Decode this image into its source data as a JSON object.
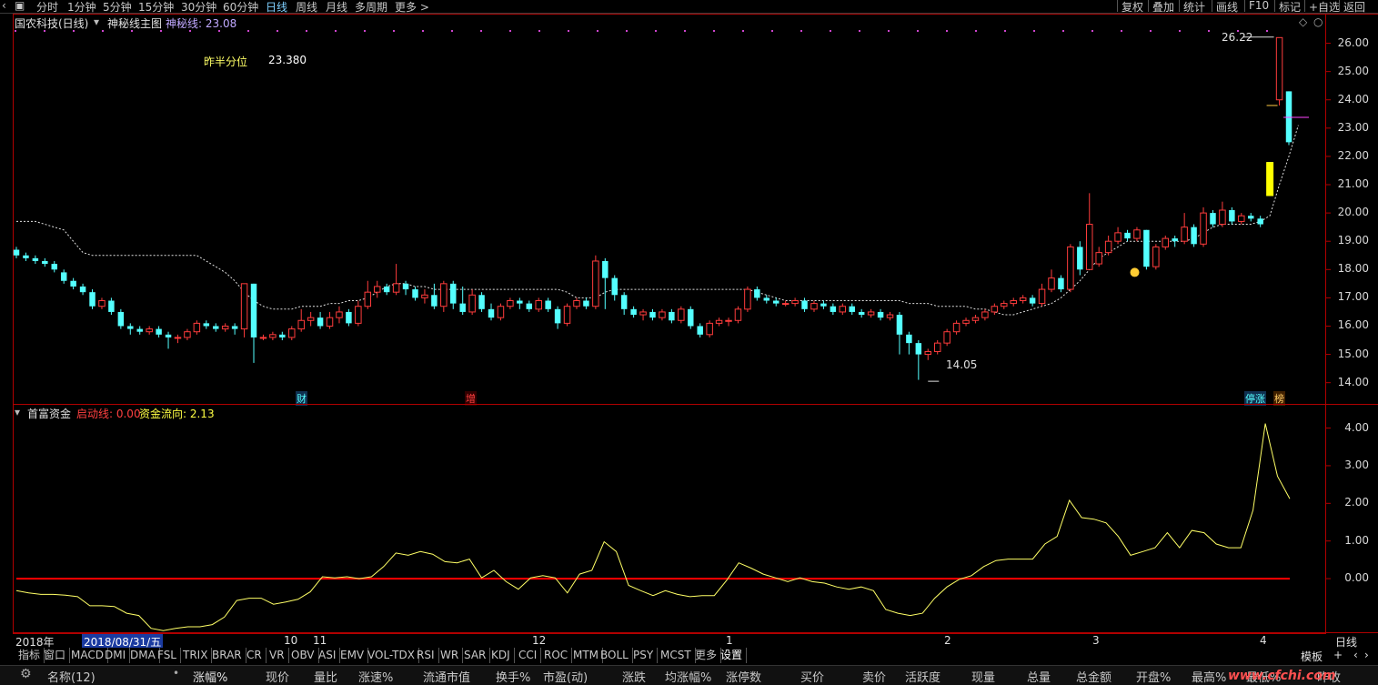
{
  "toolbar": {
    "periods": [
      "分时",
      "1分钟",
      "5分钟",
      "15分钟",
      "30分钟",
      "60分钟",
      "日线",
      "周线",
      "月线",
      "多周期",
      "更多 >"
    ],
    "active_period": "日线",
    "right_buttons": [
      "复权",
      "叠加",
      "统计",
      "画线",
      "F10",
      "标记",
      "+自选",
      "返回"
    ]
  },
  "main_pane": {
    "title": "国农科技(日线)",
    "indicator_name": "神秘线主图",
    "indicator_value_label": "神秘线: 23.08",
    "half_label": "昨半分位",
    "half_value": "23.380",
    "high_label": "26.22",
    "low_label": "14.05",
    "event_marks": [
      "财",
      "增",
      "停涨",
      "榜"
    ],
    "y_ticks": [
      "26.00",
      "25.00",
      "24.00",
      "23.00",
      "22.00",
      "21.00",
      "20.00",
      "19.00",
      "18.00",
      "17.00",
      "16.00",
      "15.00",
      "14.00"
    ]
  },
  "sub_pane": {
    "name": "首富资金",
    "line1_label": "启动线: 0.00",
    "line2_label": "资金流向: 2.13",
    "y_ticks": [
      "4.00",
      "3.00",
      "2.00",
      "1.00",
      "0.00"
    ]
  },
  "time_axis": {
    "year": "2018年",
    "cursor_date": "2018/08/31/五",
    "months": [
      "10",
      "11",
      "12",
      "1",
      "2",
      "3",
      "4"
    ],
    "period_label": "日线"
  },
  "indicator_tabs": [
    "指标",
    "窗口",
    "MACD",
    "DMI",
    "DMA",
    "FSL",
    "TRIX",
    "BRAR",
    "CR",
    "VR",
    "OBV",
    "ASI",
    "EMV",
    "VOL-TDX",
    "RSI",
    "WR",
    "SAR",
    "KDJ",
    "CCI",
    "ROC",
    "MTM",
    "BOLL",
    "PSY",
    "MCST",
    "更多",
    "设置"
  ],
  "template_label": "模板",
  "quote_header": [
    "名称(12)",
    "涨幅%",
    "现价",
    "量比",
    "涨速%",
    "流通市值",
    "换手%",
    "市盈(动)",
    "涨跌",
    "均涨幅%",
    "涨停数",
    "买价",
    "卖价",
    "活跃度",
    "现量",
    "总量",
    "总金额",
    "开盘%",
    "最高%",
    "最低%",
    "昨收"
  ],
  "watermark": "www.cfchi.com",
  "colors": {
    "up": "#ff3c3c",
    "down": "#54ffff",
    "yellow": "#ffff00",
    "red_line": "#ff0000",
    "border": "#b00000"
  },
  "chart_data": [
    {
      "type": "candlestick",
      "ylim": [
        13.7,
        26.5
      ],
      "candles": [
        [
          18.7,
          18.5,
          18.8,
          18.4
        ],
        [
          18.5,
          18.4,
          18.6,
          18.3
        ],
        [
          18.4,
          18.3,
          18.5,
          18.2
        ],
        [
          18.3,
          18.2,
          18.4,
          18.1
        ],
        [
          18.2,
          18.0,
          18.3,
          17.9
        ],
        [
          17.9,
          17.6,
          18.0,
          17.5
        ],
        [
          17.6,
          17.4,
          17.7,
          17.3
        ],
        [
          17.4,
          17.2,
          17.5,
          17.1
        ],
        [
          17.2,
          16.7,
          17.3,
          16.6
        ],
        [
          16.7,
          16.9,
          17.0,
          16.6
        ],
        [
          16.9,
          16.5,
          17.0,
          16.4
        ],
        [
          16.5,
          16.0,
          16.6,
          15.9
        ],
        [
          16.0,
          15.9,
          16.1,
          15.7
        ],
        [
          15.9,
          15.8,
          16.0,
          15.7
        ],
        [
          15.8,
          15.9,
          16.0,
          15.7
        ],
        [
          15.9,
          15.7,
          16.0,
          15.6
        ],
        [
          15.7,
          15.6,
          15.8,
          15.2
        ],
        [
          15.6,
          15.6,
          15.7,
          15.4
        ],
        [
          15.6,
          15.8,
          15.9,
          15.5
        ],
        [
          15.8,
          16.1,
          16.2,
          15.7
        ],
        [
          16.1,
          16.0,
          16.2,
          15.9
        ],
        [
          16.0,
          15.9,
          16.1,
          15.8
        ],
        [
          15.9,
          16.0,
          16.1,
          15.8
        ],
        [
          16.0,
          15.9,
          16.1,
          15.7
        ],
        [
          15.9,
          17.5,
          17.5,
          15.6
        ],
        [
          17.5,
          15.6,
          17.5,
          14.7
        ],
        [
          15.6,
          15.6,
          15.7,
          15.5
        ],
        [
          15.6,
          15.7,
          15.8,
          15.5
        ],
        [
          15.7,
          15.6,
          15.8,
          15.5
        ],
        [
          15.6,
          15.9,
          16.0,
          15.5
        ],
        [
          15.9,
          16.2,
          16.6,
          15.8
        ],
        [
          16.2,
          16.3,
          16.5,
          16.0
        ],
        [
          16.3,
          16.0,
          16.5,
          15.9
        ],
        [
          16.0,
          16.3,
          16.5,
          15.9
        ],
        [
          16.3,
          16.5,
          16.7,
          16.1
        ],
        [
          16.5,
          16.1,
          16.6,
          16.0
        ],
        [
          16.1,
          16.7,
          16.9,
          16.0
        ],
        [
          16.7,
          17.2,
          17.6,
          16.6
        ],
        [
          17.2,
          17.4,
          17.6,
          17.0
        ],
        [
          17.4,
          17.2,
          17.5,
          17.1
        ],
        [
          17.2,
          17.5,
          18.2,
          17.1
        ],
        [
          17.5,
          17.3,
          17.6,
          17.1
        ],
        [
          17.3,
          17.0,
          17.4,
          16.9
        ],
        [
          17.0,
          17.1,
          17.3,
          16.8
        ],
        [
          17.1,
          16.7,
          17.5,
          16.6
        ],
        [
          16.7,
          17.5,
          17.6,
          16.5
        ],
        [
          17.5,
          16.8,
          17.6,
          16.6
        ],
        [
          16.8,
          16.5,
          17.4,
          16.4
        ],
        [
          16.5,
          17.1,
          17.3,
          16.4
        ],
        [
          17.1,
          16.6,
          17.2,
          16.5
        ],
        [
          16.6,
          16.3,
          16.8,
          16.2
        ],
        [
          16.3,
          16.7,
          16.8,
          16.2
        ],
        [
          16.7,
          16.9,
          17.0,
          16.6
        ],
        [
          16.9,
          16.8,
          17.0,
          16.6
        ],
        [
          16.8,
          16.6,
          16.9,
          16.5
        ],
        [
          16.6,
          16.9,
          17.0,
          16.5
        ],
        [
          16.9,
          16.6,
          17.0,
          16.5
        ],
        [
          16.6,
          16.1,
          16.7,
          15.9
        ],
        [
          16.1,
          16.7,
          16.8,
          16.0
        ],
        [
          16.7,
          16.9,
          17.0,
          16.6
        ],
        [
          16.9,
          16.7,
          17.0,
          16.6
        ],
        [
          16.7,
          18.3,
          18.5,
          16.6
        ],
        [
          18.3,
          17.7,
          18.4,
          16.6
        ],
        [
          17.7,
          17.1,
          17.8,
          16.9
        ],
        [
          17.1,
          16.6,
          17.2,
          16.4
        ],
        [
          16.6,
          16.4,
          16.7,
          16.3
        ],
        [
          16.4,
          16.5,
          16.6,
          16.2
        ],
        [
          16.5,
          16.3,
          16.6,
          16.2
        ],
        [
          16.3,
          16.5,
          16.6,
          16.2
        ],
        [
          16.5,
          16.2,
          16.6,
          16.1
        ],
        [
          16.2,
          16.6,
          16.7,
          16.1
        ],
        [
          16.6,
          16.0,
          16.7,
          15.9
        ],
        [
          16.0,
          15.7,
          16.1,
          15.6
        ],
        [
          15.7,
          16.1,
          16.2,
          15.6
        ],
        [
          16.1,
          16.2,
          16.3,
          16.0
        ],
        [
          16.2,
          16.2,
          16.3,
          16.0
        ],
        [
          16.2,
          16.6,
          16.7,
          16.1
        ],
        [
          16.6,
          17.3,
          17.4,
          16.5
        ],
        [
          17.3,
          17.0,
          17.4,
          16.9
        ],
        [
          17.0,
          16.9,
          17.1,
          16.8
        ],
        [
          16.9,
          16.8,
          17.0,
          16.7
        ],
        [
          16.8,
          16.8,
          16.9,
          16.7
        ],
        [
          16.8,
          16.9,
          17.0,
          16.7
        ],
        [
          16.9,
          16.6,
          17.0,
          16.5
        ],
        [
          16.6,
          16.8,
          16.9,
          16.5
        ],
        [
          16.8,
          16.7,
          16.9,
          16.6
        ],
        [
          16.7,
          16.5,
          16.8,
          16.4
        ],
        [
          16.5,
          16.7,
          16.8,
          16.4
        ],
        [
          16.7,
          16.5,
          16.8,
          16.4
        ],
        [
          16.5,
          16.4,
          16.6,
          16.3
        ],
        [
          16.4,
          16.5,
          16.6,
          16.3
        ],
        [
          16.5,
          16.3,
          16.6,
          16.2
        ],
        [
          16.3,
          16.4,
          16.5,
          16.2
        ],
        [
          16.4,
          15.7,
          16.5,
          15.0
        ],
        [
          15.7,
          15.4,
          15.8,
          15.0
        ],
        [
          15.4,
          15.0,
          15.5,
          14.1
        ],
        [
          15.0,
          15.1,
          15.2,
          14.8
        ],
        [
          15.1,
          15.4,
          15.5,
          15.0
        ],
        [
          15.4,
          15.8,
          15.9,
          15.3
        ],
        [
          15.8,
          16.1,
          16.2,
          15.7
        ],
        [
          16.1,
          16.2,
          16.3,
          16.0
        ],
        [
          16.2,
          16.3,
          16.4,
          16.1
        ],
        [
          16.3,
          16.5,
          16.6,
          16.2
        ],
        [
          16.5,
          16.7,
          16.8,
          16.4
        ],
        [
          16.7,
          16.8,
          16.9,
          16.6
        ],
        [
          16.8,
          16.9,
          17.0,
          16.7
        ],
        [
          16.9,
          17.0,
          17.1,
          16.8
        ],
        [
          17.0,
          16.8,
          17.1,
          16.7
        ],
        [
          16.8,
          17.3,
          17.5,
          16.7
        ],
        [
          17.3,
          17.7,
          18.0,
          17.2
        ],
        [
          17.7,
          17.3,
          17.8,
          17.2
        ],
        [
          17.3,
          18.8,
          18.9,
          17.2
        ],
        [
          18.8,
          18.0,
          19.0,
          17.8
        ],
        [
          18.0,
          19.6,
          20.7,
          19.3
        ],
        [
          18.2,
          18.6,
          18.8,
          18.1
        ],
        [
          18.6,
          19.0,
          19.2,
          18.5
        ],
        [
          19.0,
          19.3,
          19.5,
          18.9
        ],
        [
          19.3,
          19.1,
          19.4,
          19.0
        ],
        [
          19.1,
          19.4,
          19.5,
          19.0
        ],
        [
          19.4,
          18.1,
          19.4,
          18.0
        ],
        [
          18.1,
          18.8,
          18.9,
          18.0
        ],
        [
          18.8,
          19.1,
          19.2,
          18.7
        ],
        [
          19.1,
          19.0,
          19.2,
          18.8
        ],
        [
          19.0,
          19.5,
          20.0,
          18.9
        ],
        [
          19.5,
          18.9,
          19.6,
          18.8
        ],
        [
          18.9,
          20.0,
          20.2,
          18.8
        ],
        [
          20.0,
          19.6,
          20.1,
          19.5
        ],
        [
          19.6,
          20.1,
          20.4,
          19.5
        ],
        [
          20.1,
          19.7,
          20.2,
          19.6
        ],
        [
          19.7,
          19.9,
          20.0,
          19.6
        ],
        [
          19.9,
          19.8,
          20.0,
          19.7
        ],
        [
          19.8,
          19.6,
          19.9,
          19.5
        ],
        [
          21.8,
          20.6,
          21.8,
          20.6
        ],
        [
          24.0,
          26.2,
          26.2,
          23.8
        ],
        [
          24.3,
          22.5,
          24.3,
          22.4
        ]
      ],
      "line": [
        19.7,
        19.7,
        19.7,
        19.6,
        19.5,
        19.4,
        19.0,
        18.6,
        18.5,
        18.5,
        18.5,
        18.5,
        18.5,
        18.5,
        18.5,
        18.5,
        18.5,
        18.5,
        18.5,
        18.5,
        18.3,
        18.1,
        17.9,
        17.6,
        17.2,
        16.9,
        16.7,
        16.6,
        16.6,
        16.6,
        16.7,
        16.7,
        16.7,
        16.8,
        16.8,
        16.9,
        16.9,
        17.0,
        17.2,
        17.4,
        17.5,
        17.5,
        17.4,
        17.4,
        17.3,
        17.3,
        17.3,
        17.3,
        17.3,
        17.3,
        17.3,
        17.3,
        17.3,
        17.3,
        17.3,
        17.3,
        17.3,
        17.3,
        17.2,
        17.0,
        17.0,
        17.0,
        17.2,
        17.3,
        17.3,
        17.3,
        17.3,
        17.3,
        17.3,
        17.3,
        17.3,
        17.3,
        17.3,
        17.3,
        17.3,
        17.3,
        17.3,
        17.3,
        17.2,
        17.1,
        17.0,
        16.9,
        16.9,
        16.9,
        16.9,
        16.9,
        16.9,
        16.9,
        16.9,
        16.9,
        16.9,
        16.9,
        16.9,
        16.9,
        16.8,
        16.8,
        16.8,
        16.7,
        16.7,
        16.7,
        16.7,
        16.6,
        16.6,
        16.5,
        16.4,
        16.4,
        16.5,
        16.6,
        16.7,
        16.8,
        17.0,
        17.3,
        17.6,
        18.0,
        18.4,
        18.6,
        18.8,
        19.0,
        19.0,
        19.0,
        19.0,
        19.0,
        19.0,
        19.0,
        19.1,
        19.3,
        19.5,
        19.6,
        19.6,
        19.6,
        19.6,
        19.7,
        19.9,
        21.0,
        22.0,
        23.1
      ]
    },
    {
      "type": "line",
      "ylim": [
        -1.4,
        4.4
      ],
      "series": [
        {
          "name": "启动线",
          "values": [
            0,
            0
          ]
        },
        {
          "name": "资金流向",
          "values": [
            -0.32,
            -0.38,
            -0.42,
            -0.42,
            -0.44,
            -0.48,
            -0.72,
            -0.72,
            -0.74,
            -0.92,
            -0.98,
            -1.32,
            -1.38,
            -1.32,
            -1.28,
            -1.28,
            -1.22,
            -1.02,
            -0.58,
            -0.52,
            -0.52,
            -0.68,
            -0.62,
            -0.55,
            -0.35,
            0.05,
            0.02,
            0.05,
            0.0,
            0.05,
            0.32,
            0.68,
            0.62,
            0.72,
            0.65,
            0.45,
            0.42,
            0.52,
            0.02,
            0.22,
            -0.08,
            -0.28,
            0.02,
            0.08,
            0.02,
            -0.38,
            0.12,
            0.22,
            0.98,
            0.72,
            -0.18,
            -0.32,
            -0.45,
            -0.32,
            -0.42,
            -0.48,
            -0.45,
            -0.45,
            -0.05,
            0.42,
            0.28,
            0.12,
            0.02,
            -0.08,
            0.02,
            -0.08,
            -0.12,
            -0.22,
            -0.28,
            -0.22,
            -0.32,
            -0.82,
            -0.92,
            -0.98,
            -0.92,
            -0.52,
            -0.22,
            -0.02,
            0.08,
            0.32,
            0.48,
            0.52,
            0.52,
            0.52,
            0.92,
            1.12,
            2.08,
            1.62,
            1.58,
            1.48,
            1.12,
            0.62,
            0.72,
            0.82,
            1.22,
            0.82,
            1.28,
            1.22,
            0.92,
            0.82,
            0.82,
            1.82,
            4.12,
            2.72,
            2.12
          ]
        }
      ]
    }
  ]
}
